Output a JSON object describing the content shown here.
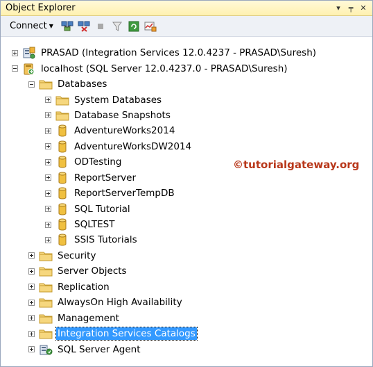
{
  "panel": {
    "title": "Object Explorer",
    "controls": [
      "▾",
      "╤",
      "✕"
    ]
  },
  "toolbar": {
    "connect_label": "Connect",
    "buttons": [
      "connect-server-icon",
      "disconnect-icon",
      "stop-icon",
      "filter-icon",
      "refresh-icon",
      "activity-monitor-icon"
    ]
  },
  "tree": {
    "integration_server": "PRASAD (Integration Services 12.0.4237 - PRASAD\\Suresh)",
    "localhost": "localhost (SQL Server 12.0.4237.0 - PRASAD\\Suresh)",
    "databases": "Databases",
    "database_items": [
      {
        "label": "System Databases",
        "icon": "folder"
      },
      {
        "label": "Database Snapshots",
        "icon": "folder"
      },
      {
        "label": "AdventureWorks2014",
        "icon": "database"
      },
      {
        "label": "AdventureWorksDW2014",
        "icon": "database"
      },
      {
        "label": "ODTesting",
        "icon": "database"
      },
      {
        "label": "ReportServer",
        "icon": "database"
      },
      {
        "label": "ReportServerTempDB",
        "icon": "database"
      },
      {
        "label": "SQL Tutorial",
        "icon": "database"
      },
      {
        "label": "SQLTEST",
        "icon": "database"
      },
      {
        "label": "SSIS Tutorials",
        "icon": "database"
      }
    ],
    "server_items": [
      {
        "label": "Security",
        "icon": "folder"
      },
      {
        "label": "Server Objects",
        "icon": "folder"
      },
      {
        "label": "Replication",
        "icon": "folder"
      },
      {
        "label": "AlwaysOn High Availability",
        "icon": "folder"
      },
      {
        "label": "Management",
        "icon": "folder"
      },
      {
        "label": "Integration Services Catalogs",
        "icon": "folder",
        "selected": true
      },
      {
        "label": "SQL Server Agent",
        "icon": "agent"
      }
    ]
  },
  "watermark": "©tutorialgateway.org"
}
